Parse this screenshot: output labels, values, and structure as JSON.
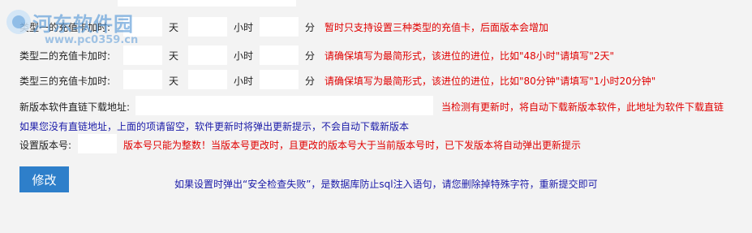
{
  "rows": [
    {
      "label": "类型一的充值卡加时:",
      "day": "天",
      "hour": "小时",
      "minute": "分",
      "note": "暂时只支持设置三种类型的充值卡，后面版本会增加"
    },
    {
      "label": "类型二的充值卡加时:",
      "day": "天",
      "hour": "小时",
      "minute": "分",
      "note": "请确保填写为最简形式，该进位的进位，比如\"48小时\"请填写\"2天\""
    },
    {
      "label": "类型三的充值卡加时:",
      "day": "天",
      "hour": "小时",
      "minute": "分",
      "note": "请确保填写为最简形式，该进位的进位，比如\"80分钟\"请填写\"1小时20分钟\""
    }
  ],
  "download": {
    "label": "新版本软件直链下载地址:",
    "note": "当检测有更新时，将自动下载新版本软件，此地址为软件下载直链",
    "hint": "如果您没有直链地址，上面的项请留空，软件更新时将弹出更新提示，不会自动下载新版本"
  },
  "version": {
    "label": "设置版本号:",
    "note": "版本号只能为整数！当版本号更改时，且更改的版本号大于当前版本号时，已下发版本将自动弹出更新提示"
  },
  "submit_label": "修改",
  "footer_note": "如果设置时弹出“安全检查失败”，是数据库防止sql注入语句，请您删除掉特殊字符，重新提交即可",
  "watermark": {
    "title": "河东软件园",
    "url": "www.pc0359.cn"
  }
}
